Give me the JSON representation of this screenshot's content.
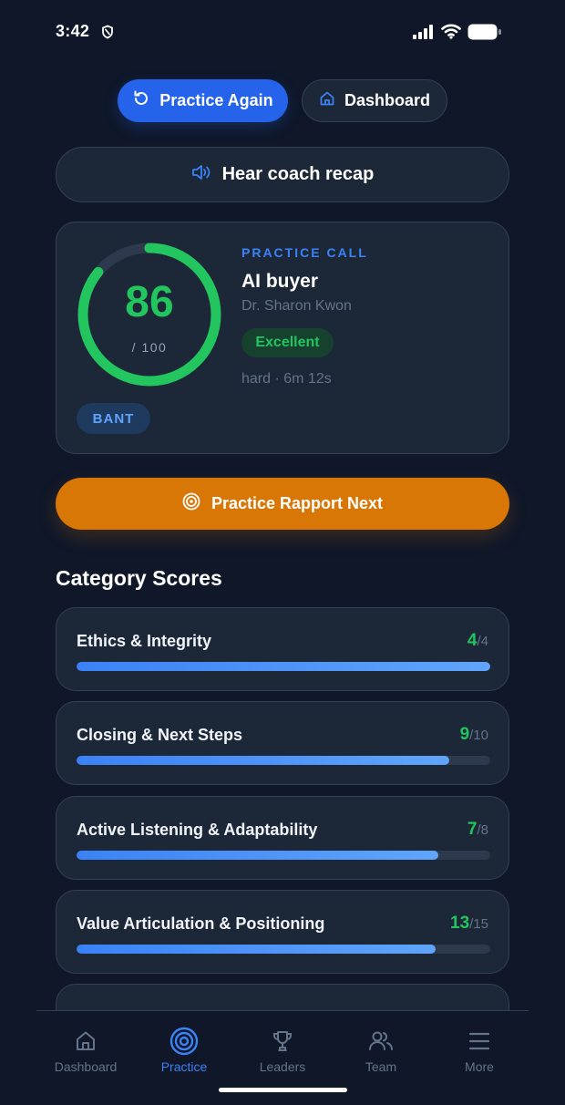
{
  "status_bar": {
    "time": "3:42",
    "icons": [
      "shield-icon",
      "signal-icon",
      "wifi-icon",
      "battery-icon"
    ]
  },
  "actions": {
    "practice_again": "Practice Again",
    "dashboard": "Dashboard",
    "coach_recap": "Hear coach recap",
    "rapport_next": "Practice Rapport Next"
  },
  "score_card": {
    "score": "86",
    "max": "/ 100",
    "score_fraction": 0.86,
    "call_type": "PRACTICE CALL",
    "buyer_title": "AI buyer",
    "buyer_name": "Dr. Sharon Kwon",
    "rating": "Excellent",
    "meta": "hard · 6m 12s",
    "framework": "BANT"
  },
  "category_section": {
    "title": "Category Scores",
    "categories": [
      {
        "name": "Ethics & Integrity",
        "score": "4",
        "max": "/4",
        "fraction": 1.0
      },
      {
        "name": "Closing & Next Steps",
        "score": "9",
        "max": "/10",
        "fraction": 0.9
      },
      {
        "name": "Active Listening & Adaptability",
        "score": "7",
        "max": "/8",
        "fraction": 0.875
      },
      {
        "name": "Value Articulation & Positioning",
        "score": "13",
        "max": "/15",
        "fraction": 0.867
      }
    ]
  },
  "bottom_nav": {
    "items": [
      {
        "label": "Dashboard",
        "icon": "home-icon"
      },
      {
        "label": "Practice",
        "icon": "target-icon",
        "active": true
      },
      {
        "label": "Leaders",
        "icon": "trophy-icon"
      },
      {
        "label": "Team",
        "icon": "users-icon"
      },
      {
        "label": "More",
        "icon": "menu-icon"
      }
    ]
  },
  "colors": {
    "background": "#0f1729",
    "card": "#1c2738",
    "primary": "#2563eb",
    "success": "#22c55e",
    "warning": "#d97706"
  }
}
